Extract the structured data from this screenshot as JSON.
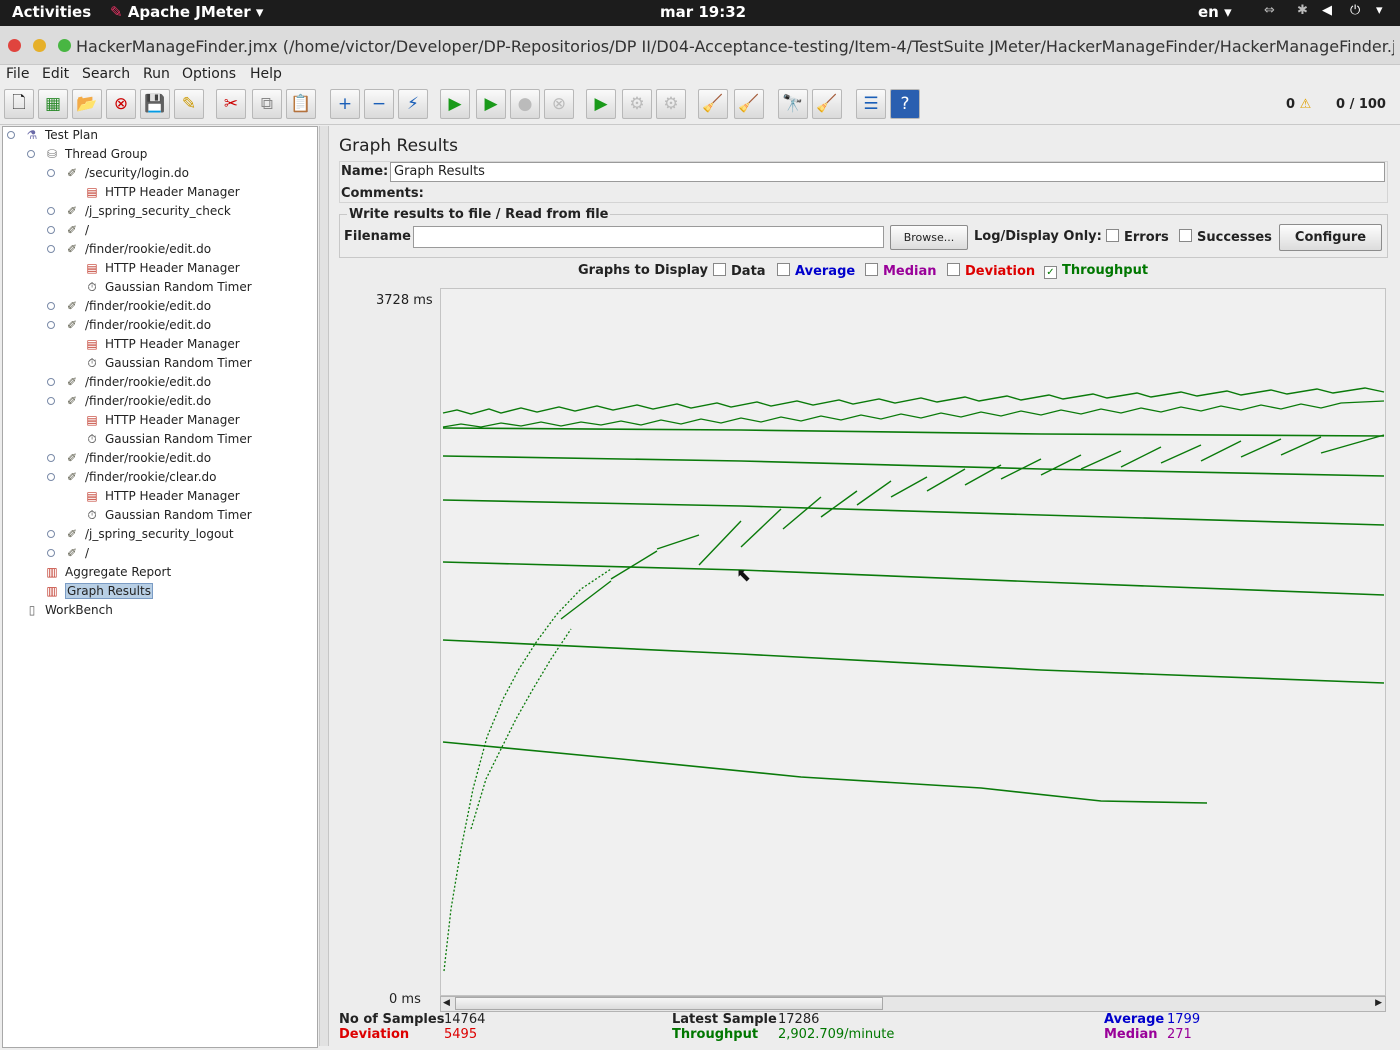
{
  "system_bar": {
    "activities": "Activities",
    "app_menu": "Apache JMeter",
    "clock": "mar 19:32",
    "language": "en"
  },
  "window": {
    "title": "HackerManageFinder.jmx (/home/victor/Developer/DP-Repositorios/DP II/D04-Acceptance-testing/Item-4/TestSuite JMeter/HackerManageFinder/HackerManageFinder.jmx) - Apache J..."
  },
  "menu": {
    "file": "File",
    "edit": "Edit",
    "search": "Search",
    "run": "Run",
    "options": "Options",
    "help": "Help"
  },
  "toolbar": {
    "warnings": "0",
    "threads": "0 / 100"
  },
  "tree": [
    "Test Plan",
    "Thread Group",
    "/security/login.do",
    "HTTP Header Manager",
    "/j_spring_security_check",
    "/",
    "/finder/rookie/edit.do",
    "HTTP Header Manager",
    "Gaussian Random Timer",
    "/finder/rookie/edit.do",
    "/finder/rookie/edit.do",
    "HTTP Header Manager",
    "Gaussian Random Timer",
    "/finder/rookie/edit.do",
    "/finder/rookie/edit.do",
    "HTTP Header Manager",
    "Gaussian Random Timer",
    "/finder/rookie/edit.do",
    "/finder/rookie/clear.do",
    "HTTP Header Manager",
    "Gaussian Random Timer",
    "/j_spring_security_logout",
    "/",
    "Aggregate Report",
    "Graph Results",
    "WorkBench"
  ],
  "panel": {
    "heading": "Graph Results",
    "name_label": "Name:",
    "name_value": "Graph Results",
    "comments_label": "Comments:",
    "file_section": "Write results to file / Read from file",
    "filename_label": "Filename",
    "filename_value": "",
    "browse": "Browse...",
    "log_display": "Log/Display Only:",
    "errors": "Errors",
    "successes": "Successes",
    "configure": "Configure",
    "graphs_to_display": "Graphs to Display",
    "data": "Data",
    "average": "Average",
    "median": "Median",
    "deviation": "Deviation",
    "throughput": "Throughput"
  },
  "graph": {
    "y_max": "3728 ms",
    "y_min": "0 ms"
  },
  "stats": {
    "samples_label": "No of Samples",
    "samples_value": "14764",
    "deviation_label": "Deviation",
    "deviation_value": "5495",
    "latest_label": "Latest Sample",
    "latest_value": "17286",
    "throughput_label": "Throughput",
    "throughput_value": "2,902.709/minute",
    "average_label": "Average",
    "average_value": "1799",
    "median_label": "Median",
    "median_value": "271"
  },
  "colors": {
    "average": "#0000cc",
    "median": "#990099",
    "deviation": "#dd0000",
    "throughput": "#007700",
    "accent": "#3a6fb0"
  }
}
